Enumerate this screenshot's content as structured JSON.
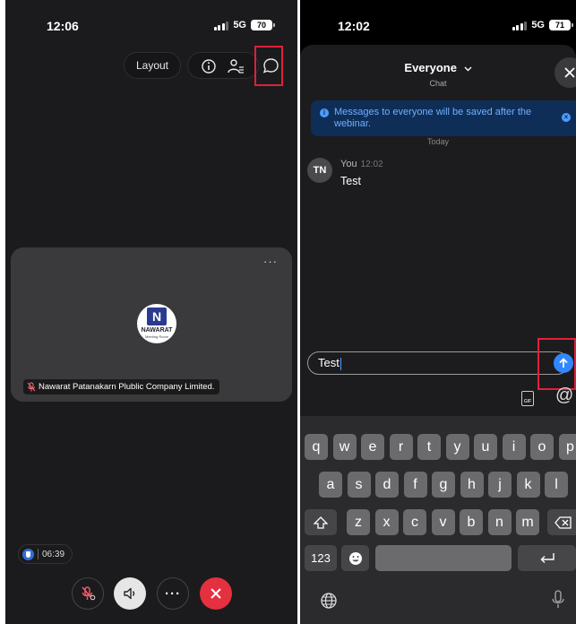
{
  "left": {
    "status": {
      "time": "12:06",
      "network": "5G",
      "battery": "70"
    },
    "toolbar": {
      "layout_label": "Layout"
    },
    "icons": {
      "info": "info-icon",
      "participants": "participants-icon",
      "chat": "chat-icon"
    },
    "tile": {
      "more": "···",
      "logo_text": "NAWARAT",
      "logo_sub": "Meeting Room",
      "participant_name": "Nawarat Patanakarn Plublic Company Limited."
    },
    "timer": "06:39",
    "controls": [
      "mic-muted",
      "speaker",
      "more",
      "end-call"
    ],
    "highlight_color": "#e0203a",
    "end_color": "#e5303f"
  },
  "right": {
    "status": {
      "time": "12:02",
      "network": "5G",
      "battery": "71"
    },
    "chat": {
      "title": "Everyone",
      "subtitle": "Chat",
      "banner": "Messages to everyone will be saved after the webinar.",
      "date_divider": "Today",
      "messages": [
        {
          "initials": "TN",
          "sender": "You",
          "time": "12:02",
          "text": "Test"
        }
      ],
      "input_value": "Test",
      "gif_label": "GIF",
      "at_label": "@"
    },
    "keyboard": {
      "row1": [
        "q",
        "w",
        "e",
        "r",
        "t",
        "y",
        "u",
        "i",
        "o",
        "p"
      ],
      "row2": [
        "a",
        "s",
        "d",
        "f",
        "g",
        "h",
        "j",
        "k",
        "l"
      ],
      "row3": [
        "z",
        "x",
        "c",
        "v",
        "b",
        "n",
        "m"
      ],
      "numbers_label": "123"
    },
    "accent_color": "#2f88ff"
  }
}
